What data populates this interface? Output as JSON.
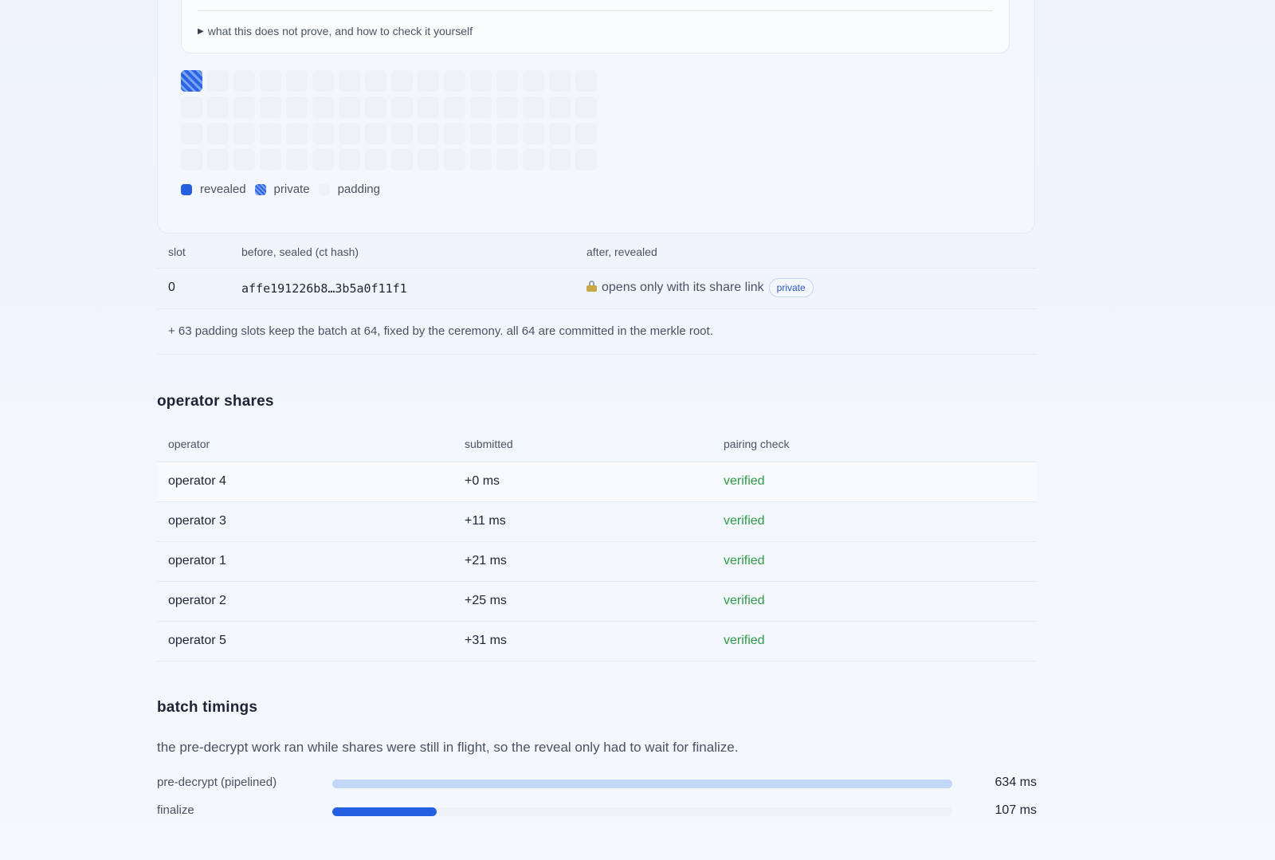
{
  "disclosure": {
    "label": "what this does not prove, and how to check it yourself"
  },
  "slot_grid": {
    "total": 64,
    "columns": 16,
    "private_count": 1
  },
  "legend": {
    "revealed": "revealed",
    "private": "private",
    "padding": "padding"
  },
  "reveal_table": {
    "headers": {
      "slot": "slot",
      "before": "before, sealed (ct hash)",
      "after": "after, revealed"
    },
    "rows": [
      {
        "slot": "0",
        "hash": "affe191226b8…3b5a0f11f1",
        "after": "opens only with its share link",
        "badge": "private"
      }
    ],
    "note": "+ 63 padding slots keep the batch at 64, fixed by the ceremony. all 64 are committed in the merkle root."
  },
  "operator_shares": {
    "title": "operator shares",
    "headers": {
      "operator": "operator",
      "submitted": "submitted",
      "pairing": "pairing check"
    },
    "rows": [
      {
        "operator": "operator 4",
        "submitted": "+0 ms",
        "pairing": "verified"
      },
      {
        "operator": "operator 3",
        "submitted": "+11 ms",
        "pairing": "verified"
      },
      {
        "operator": "operator 1",
        "submitted": "+21 ms",
        "pairing": "verified"
      },
      {
        "operator": "operator 2",
        "submitted": "+25 ms",
        "pairing": "verified"
      },
      {
        "operator": "operator 5",
        "submitted": "+31 ms",
        "pairing": "verified"
      }
    ]
  },
  "batch_timings": {
    "title": "batch timings",
    "description": "the pre-decrypt work ran while shares were still in flight, so the reveal only had to wait for finalize.",
    "max_ms": 634,
    "bars": [
      {
        "label": "pre-decrypt (pipelined)",
        "value_ms": 634,
        "value_text": "634 ms",
        "color": "#c3d8f7"
      },
      {
        "label": "finalize",
        "value_ms": 107,
        "value_text": "107 ms",
        "color": "#2560e2"
      }
    ]
  }
}
